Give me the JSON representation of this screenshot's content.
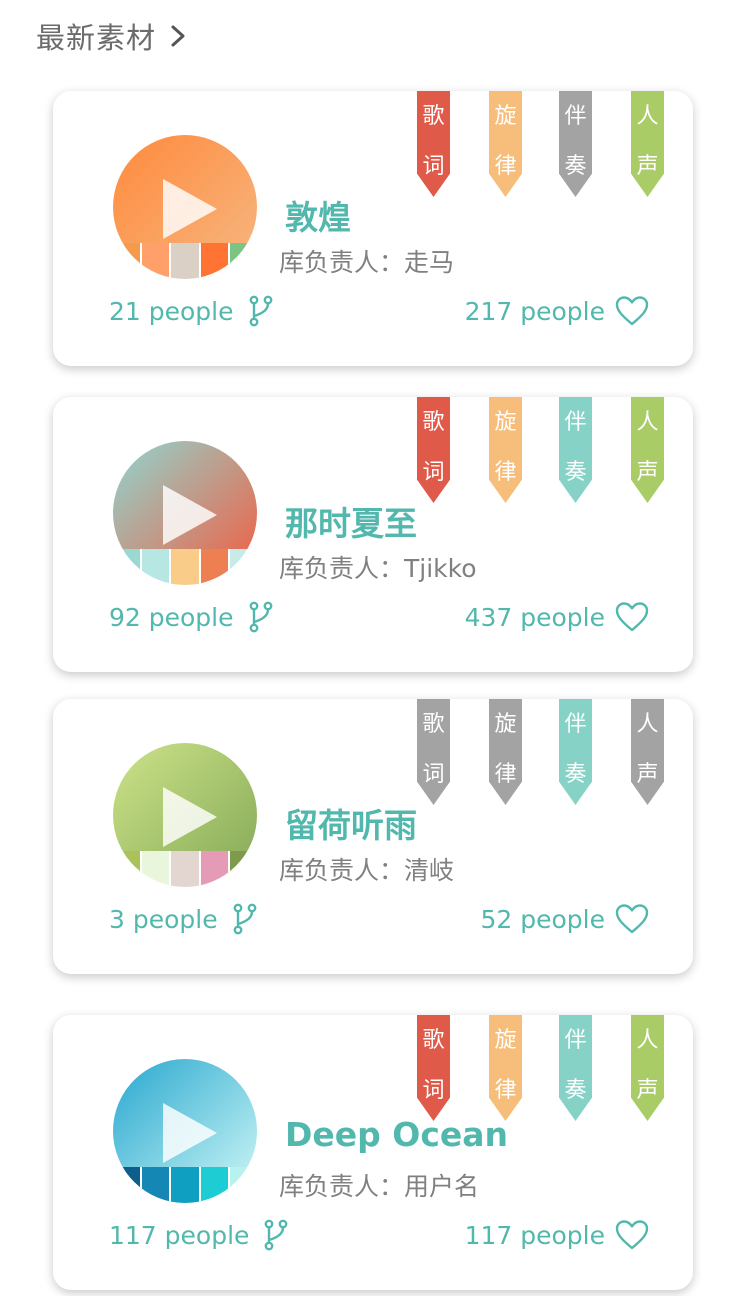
{
  "header": {
    "title": "最新素材"
  },
  "colors": {
    "accent": "#52b8ad",
    "tag_red": "#e05a4a",
    "tag_orange": "#f6be7a",
    "tag_teal": "#86d2c7",
    "tag_green": "#a9cc66",
    "tag_gray": "#a3a3a3"
  },
  "cards": [
    {
      "title": "敦煌",
      "owner": "库负责人：走马",
      "fork_count": "21 people",
      "like_count": "217 people",
      "tags": [
        {
          "label": [
            "歌",
            "词"
          ],
          "color": "#e05a4a"
        },
        {
          "label": [
            "旋",
            "律"
          ],
          "color": "#f6be7a"
        },
        {
          "label": [
            "伴",
            "奏"
          ],
          "color": "#a3a3a3"
        },
        {
          "label": [
            "人",
            "声"
          ],
          "color": "#a9cc66"
        }
      ],
      "cover_gradient": [
        "#ff8a3c",
        "#f7b27a"
      ],
      "swatches": [
        "#f39a4b",
        "#ffa06a",
        "#dbd0c6",
        "#ff7433",
        "#7cc483"
      ]
    },
    {
      "title": "那时夏至",
      "owner": "库负责人：Tjikko",
      "fork_count": "92 people",
      "like_count": "437 people",
      "tags": [
        {
          "label": [
            "歌",
            "词"
          ],
          "color": "#e05a4a"
        },
        {
          "label": [
            "旋",
            "律"
          ],
          "color": "#f6be7a"
        },
        {
          "label": [
            "伴",
            "奏"
          ],
          "color": "#86d2c7"
        },
        {
          "label": [
            "人",
            "声"
          ],
          "color": "#a9cc66"
        }
      ],
      "cover_gradient": [
        "#8fd6d0",
        "#e9694f"
      ],
      "swatches": [
        "#9ad8d2",
        "#b7e7e2",
        "#f9cc8a",
        "#ee7f52",
        "#c8ebe7"
      ]
    },
    {
      "title": "留荷听雨",
      "owner": "库负责人：清岐",
      "fork_count": "3 people",
      "like_count": "52 people",
      "tags": [
        {
          "label": [
            "歌",
            "词"
          ],
          "color": "#a3a3a3"
        },
        {
          "label": [
            "旋",
            "律"
          ],
          "color": "#a3a3a3"
        },
        {
          "label": [
            "伴",
            "奏"
          ],
          "color": "#86d2c7"
        },
        {
          "label": [
            "人",
            "声"
          ],
          "color": "#a3a3a3"
        }
      ],
      "cover_gradient": [
        "#cde389",
        "#8caf5c"
      ],
      "swatches": [
        "#a9c25a",
        "#e9f6dc",
        "#e3d5cf",
        "#e59bb6",
        "#7f9a4d"
      ]
    },
    {
      "title": "Deep Ocean",
      "owner": "库负责人：用户名",
      "fork_count": "117 people",
      "like_count": "117 people",
      "tags": [
        {
          "label": [
            "歌",
            "词"
          ],
          "color": "#e05a4a"
        },
        {
          "label": [
            "旋",
            "律"
          ],
          "color": "#f6be7a"
        },
        {
          "label": [
            "伴",
            "奏"
          ],
          "color": "#86d2c7"
        },
        {
          "label": [
            "人",
            "声"
          ],
          "color": "#a9cc66"
        }
      ],
      "cover_gradient": [
        "#28a7cf",
        "#bdeff2"
      ],
      "swatches": [
        "#0d5e8a",
        "#1587b4",
        "#0f9fc0",
        "#1dcdd3",
        "#b8f2ef"
      ]
    }
  ]
}
